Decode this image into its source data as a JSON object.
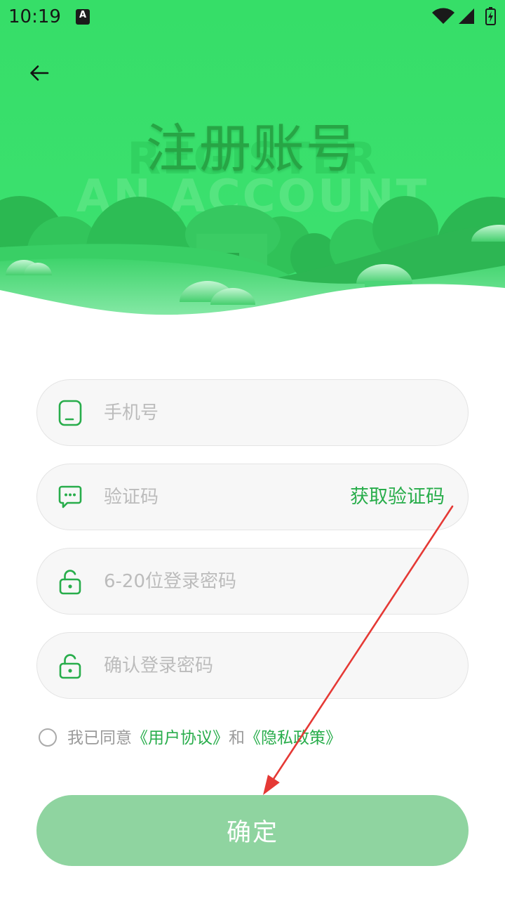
{
  "status_bar": {
    "time": "10:19",
    "notification_icon_text": "A",
    "icons": [
      "wifi-icon",
      "signal-icon",
      "battery-charging-icon"
    ]
  },
  "header": {
    "back_icon": "arrow-left-icon",
    "title": "注册账号",
    "watermark_line1": "REGISTER",
    "watermark_line2": "AN ACCOUNT"
  },
  "form": {
    "phone": {
      "icon": "phone-icon",
      "placeholder": "手机号",
      "value": ""
    },
    "code": {
      "icon": "message-icon",
      "placeholder": "验证码",
      "value": "",
      "action_label": "获取验证码"
    },
    "password": {
      "icon": "lock-icon",
      "placeholder": "6-20位登录密码",
      "value": ""
    },
    "confirm_password": {
      "icon": "lock-icon",
      "placeholder": "确认登录密码",
      "value": ""
    }
  },
  "agreement": {
    "checked": false,
    "prefix": "我已同意",
    "user_agreement": "《用户协议》",
    "conjunction": "和",
    "privacy_policy": "《隐私政策》"
  },
  "submit": {
    "label": "确定",
    "enabled": false
  },
  "annotation": {
    "icon": "red-arrow-icon",
    "color": "#e53935"
  },
  "colors": {
    "header_green": "#36de68",
    "title_green": "#27a545",
    "primary_green": "#28ad4b",
    "button_disabled": "#8fd4a0",
    "placeholder": "#bcbcbc",
    "input_bg": "#f7f7f7",
    "input_border": "#e4e4e4",
    "muted_text": "#9a9a9a",
    "annotation_red": "#e53935"
  }
}
